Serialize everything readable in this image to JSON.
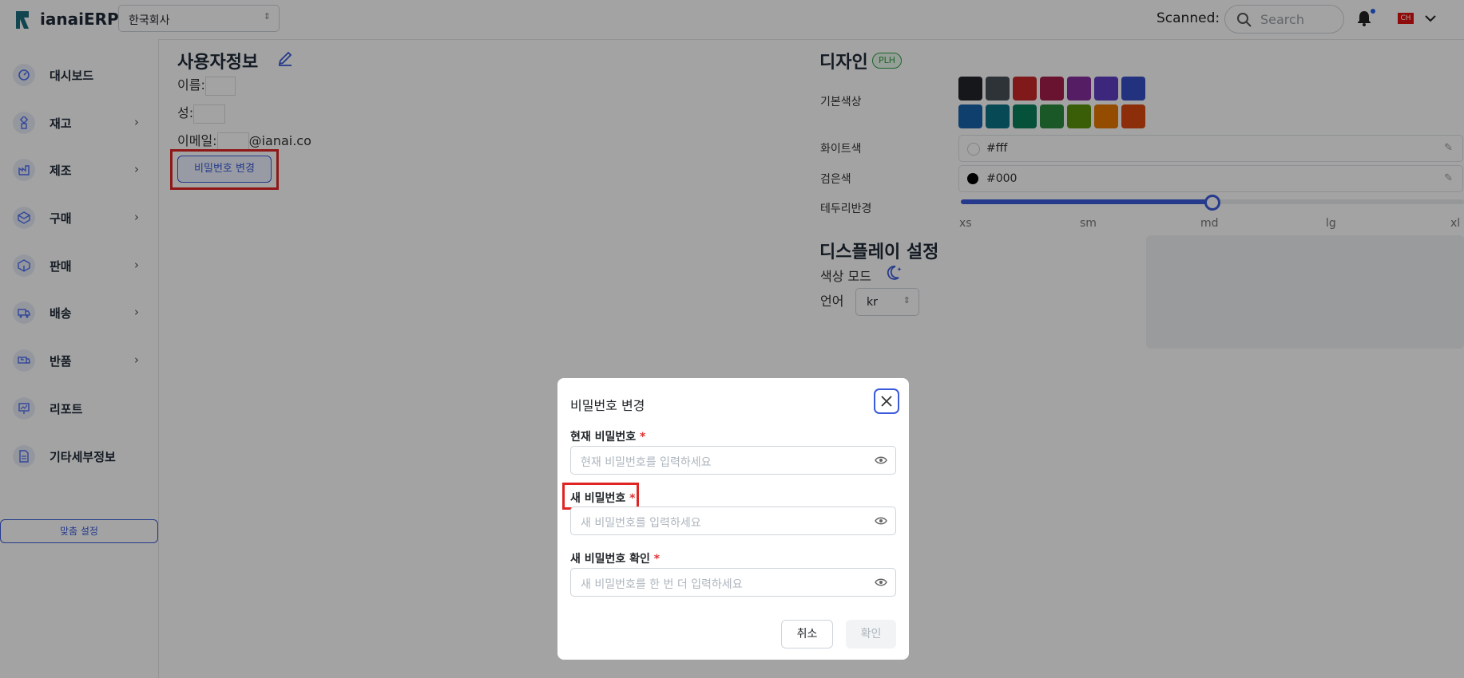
{
  "header": {
    "app_name": "ianaiERP",
    "company_select_value": "한국회사",
    "scanned_label": "Scanned:",
    "search_placeholder": "Search",
    "flag_label": "CH"
  },
  "sidebar": {
    "items": [
      {
        "label": "대시보드",
        "icon": "dashboard-icon",
        "has_submenu": false
      },
      {
        "label": "재고",
        "icon": "inventory-icon",
        "has_submenu": true
      },
      {
        "label": "제조",
        "icon": "manufacturing-icon",
        "has_submenu": true
      },
      {
        "label": "구매",
        "icon": "purchase-icon",
        "has_submenu": true
      },
      {
        "label": "판매",
        "icon": "sales-icon",
        "has_submenu": true
      },
      {
        "label": "배송",
        "icon": "shipping-icon",
        "has_submenu": true
      },
      {
        "label": "반품",
        "icon": "returns-icon",
        "has_submenu": true
      },
      {
        "label": "리포트",
        "icon": "report-icon",
        "has_submenu": false
      },
      {
        "label": "기타세부정보",
        "icon": "document-icon",
        "has_submenu": false
      }
    ],
    "custom_settings_label": "맞춤 설정"
  },
  "user_info": {
    "title": "사용자정보",
    "name_label": "이름:",
    "surname_label": "성:",
    "email_label": "이메일:",
    "email_domain": "@ianai.co",
    "change_password_label": "비밀번호 변경"
  },
  "design": {
    "title": "디자인",
    "badge": "PLH",
    "base_color_label": "기본색상",
    "swatches_row1": [
      "#212529",
      "#495057",
      "#c92a2a",
      "#a61e4d",
      "#862e9c",
      "#5f3dc4",
      "#364fc7"
    ],
    "swatches_row2": [
      "#1864ab",
      "#0b7285",
      "#087f5b",
      "#2b8a3e",
      "#5c940d",
      "#e67700",
      "#d9480f"
    ],
    "white_label": "화이트색",
    "white_value": "#fff",
    "black_label": "검은색",
    "black_value": "#000",
    "radius_label": "테두리반경",
    "radius_ticks": [
      "xs",
      "sm",
      "md",
      "lg",
      "xl"
    ],
    "radius_selected_fraction": 0.5
  },
  "display": {
    "title": "디스플레이 설정",
    "color_mode_label": "색상 모드",
    "language_label": "언어",
    "language_value": "kr"
  },
  "modal": {
    "title": "비밀번호 변경",
    "current_label": "현재 비밀번호",
    "current_placeholder": "현재 비밀번호를 입력하세요",
    "new_label": "새 비밀번호",
    "new_placeholder": "새 비밀번호를 입력하세요",
    "confirm_label": "새 비밀번호 확인",
    "confirm_placeholder": "새 비밀번호를 한 번 더 입력하세요",
    "required_mark": "*",
    "cancel_label": "취소",
    "ok_label": "확인"
  }
}
